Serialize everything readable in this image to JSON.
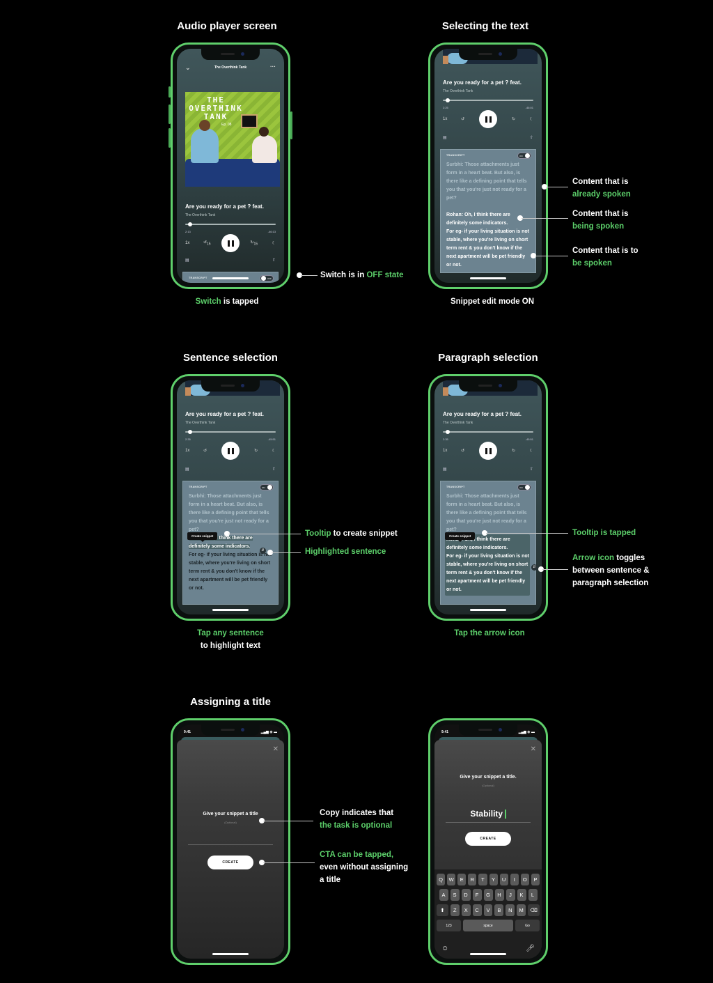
{
  "sections": {
    "audio_player": {
      "title": "Audio player screen"
    },
    "selecting_text": {
      "title": "Selecting the text"
    },
    "sentence_selection": {
      "title": "Sentence selection"
    },
    "paragraph_selection": {
      "title": "Paragraph selection"
    },
    "assigning_title": {
      "title": "Assigning a title"
    }
  },
  "captions": {
    "switch_tapped": {
      "green": "Switch",
      "white": " is tapped"
    },
    "snippet_edit": {
      "white": "Snippet edit mode ON"
    },
    "tap_sentence": {
      "green": "Tap any sentence",
      "white": "to highlight text"
    },
    "tap_arrow": {
      "green": "Tap the arrow icon"
    }
  },
  "annotations": {
    "switch_off": {
      "white": "Switch is in ",
      "green": "OFF state"
    },
    "already_spoken": {
      "white": "Content that is",
      "green": "already spoken"
    },
    "being_spoken": {
      "white": "Content that is",
      "green": "being spoken"
    },
    "to_be_spoken": {
      "white": "Content that is to",
      "green": "be spoken"
    },
    "tooltip_create": {
      "green": "Tooltip",
      "white": " to create snippet"
    },
    "highlighted": {
      "green": "Highlighted sentence"
    },
    "tooltip_tapped": {
      "green": "Tooltip is tapped"
    },
    "arrow_toggle": {
      "green": "Arrow icon",
      "white1": " toggles",
      "white2": "between sentence &",
      "white3": "paragraph selection"
    },
    "copy_optional": {
      "white": "Copy indicates that",
      "green": "the task is optional"
    },
    "cta": {
      "green": "CTA can be tapped,",
      "white1": "even without assigning",
      "white2": "a title"
    }
  },
  "player": {
    "show_name": "The Overthink Tank",
    "episode_title": "Are you ready for a pet ? feat.",
    "artwork": {
      "line1": "THE",
      "line2": "OVERTHINK",
      "line3": "TANK",
      "ep": "Ep. 08"
    },
    "speed": "1x",
    "skip_back": "15",
    "skip_fwd": "15",
    "screen1": {
      "elapsed": "2:13",
      "remaining": "-46:13",
      "progress": 0.05
    },
    "screen2": {
      "elapsed": "2:25",
      "remaining": "-46:01",
      "progress": 0.05
    },
    "screen3": {
      "elapsed": "2:35",
      "remaining": "-45:51",
      "progress": 0.05
    },
    "screen4": {
      "elapsed": "2:35",
      "remaining": "-45:51",
      "progress": 0.05
    }
  },
  "transcript": {
    "label": "TRANSCRIPT",
    "switch_off": "OFF",
    "switch_on": "ON",
    "spoken": "Surbhi: Those attachments just form in a heart beat. But also, is there like a defining point that tells you that you're just not ready for a pet?",
    "current": "Rohan: Oh, I think there are definitely some indicators.",
    "upcoming": "For eg- if your living situation is not stable, where you're living on short term rent & you don't know if the next apartment will be pet friendly or not."
  },
  "tooltip": {
    "label": "Create snippet"
  },
  "title_sheet": {
    "status_time": "9:41",
    "prompt_a": "Give your snippet a title",
    "prompt_b": "Give your snippet a title.",
    "optional": "(Optional)",
    "create_label": "CREATE",
    "typed_value": "Stability"
  },
  "keyboard": {
    "row1": [
      "Q",
      "W",
      "E",
      "R",
      "T",
      "Y",
      "U",
      "I",
      "O",
      "P"
    ],
    "row2": [
      "A",
      "S",
      "D",
      "F",
      "G",
      "H",
      "J",
      "K",
      "L"
    ],
    "row3": [
      "Z",
      "X",
      "C",
      "V",
      "B",
      "N",
      "M"
    ],
    "num_key": "123",
    "space_key": "space",
    "go_key": "Go"
  }
}
